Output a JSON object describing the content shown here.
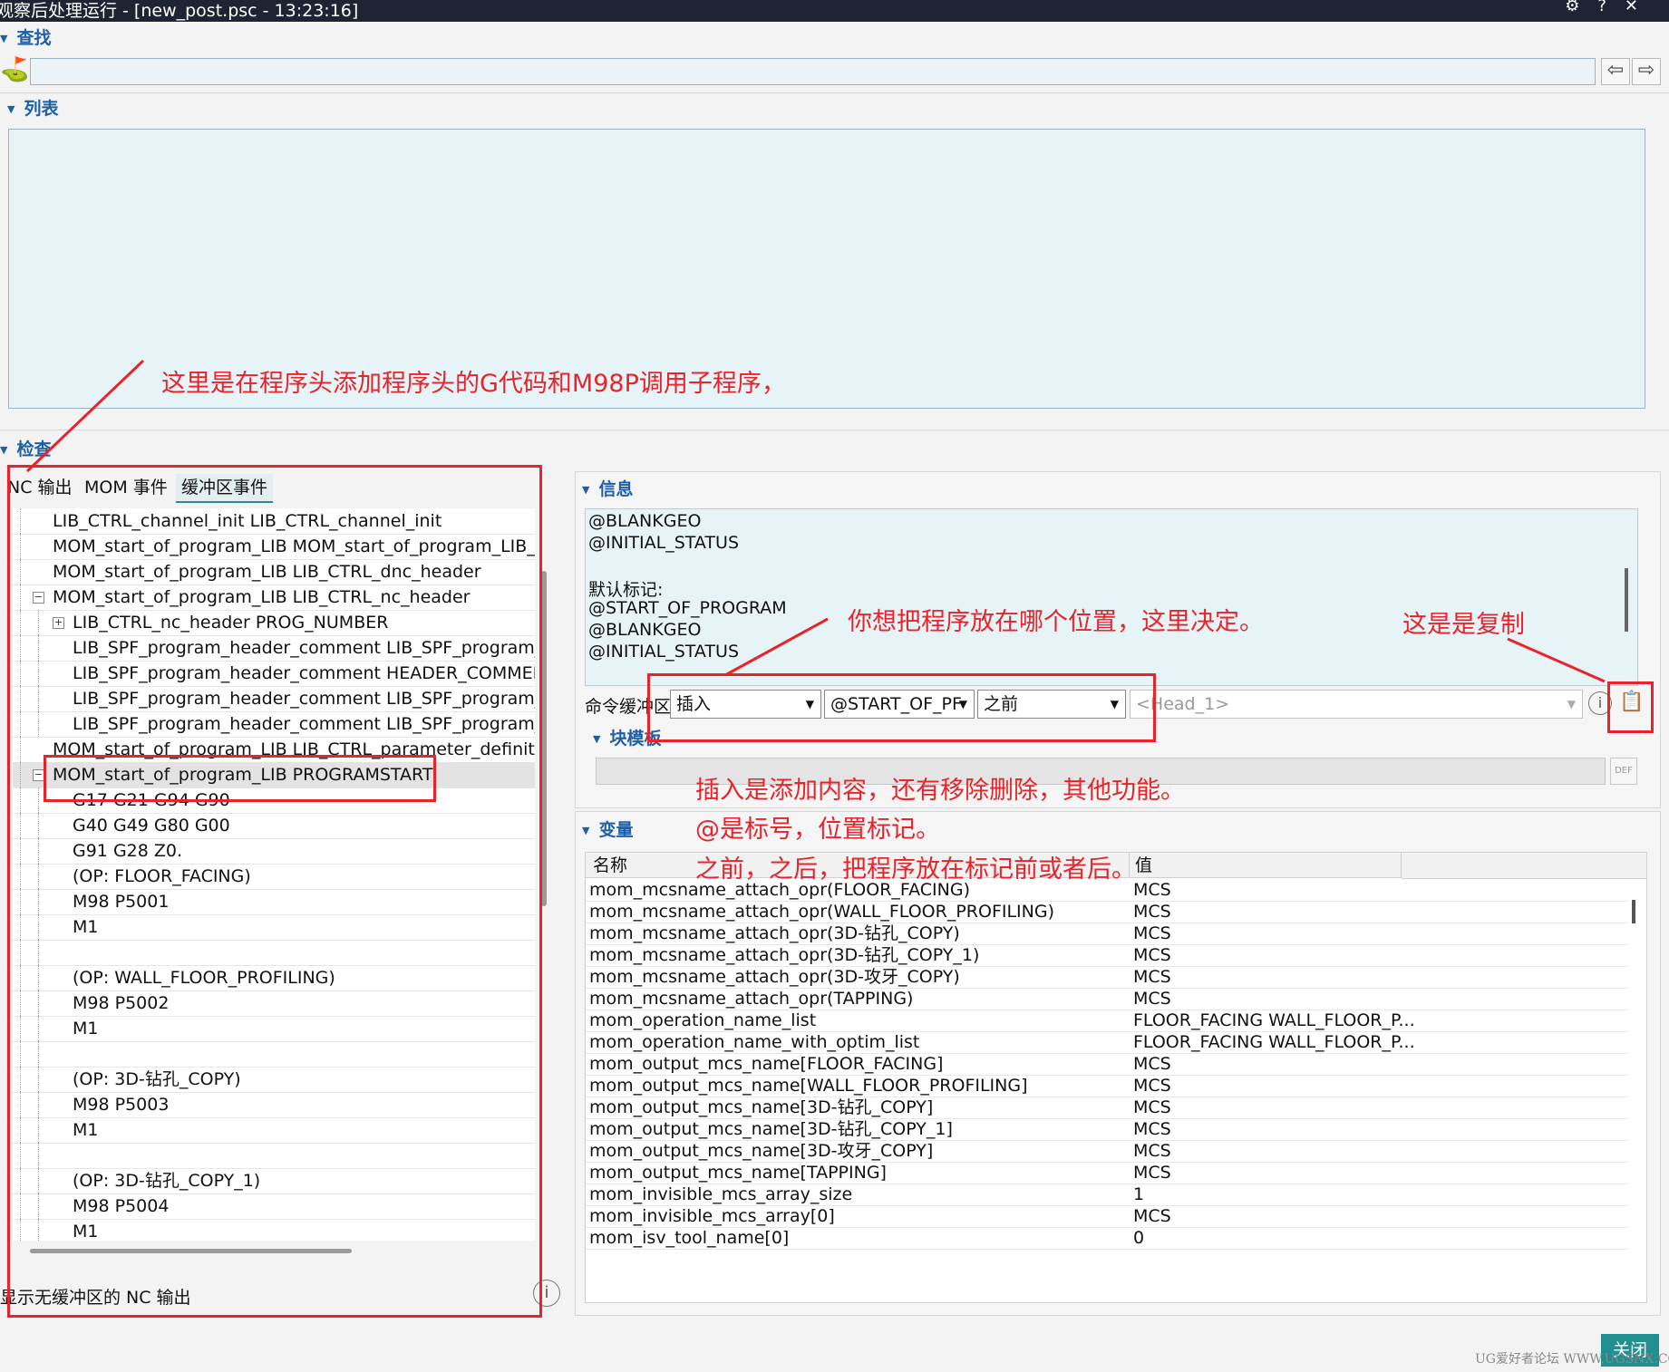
{
  "window": {
    "title": "观察后处理运行 - [new_post.psc - 13:23:16]",
    "icons": [
      "gear-icon",
      "help-icon",
      "close-icon"
    ]
  },
  "find_section": {
    "label": "查找",
    "search_value": ""
  },
  "list_section": {
    "label": "列表"
  },
  "inspect_section": {
    "label": "检查",
    "tabs": [
      "NC 输出",
      "MOM 事件",
      "缓冲区事件"
    ],
    "active_tab": "缓冲区事件",
    "tree": [
      {
        "text": "LIB_CTRL_channel_init LIB_CTRL_channel_init",
        "level": 1,
        "toggle": ""
      },
      {
        "text": "MOM_start_of_program_LIB MOM_start_of_program_LIB_ENT",
        "level": 1,
        "toggle": ""
      },
      {
        "text": "MOM_start_of_program_LIB LIB_CTRL_dnc_header",
        "level": 1,
        "toggle": ""
      },
      {
        "text": "MOM_start_of_program_LIB LIB_CTRL_nc_header",
        "level": 1,
        "toggle": "−"
      },
      {
        "text": "LIB_CTRL_nc_header PROG_NUMBER",
        "level": 2,
        "toggle": "+"
      },
      {
        "text": "LIB_SPF_program_header_comment LIB_SPF_program_heac",
        "level": 2,
        "toggle": ""
      },
      {
        "text": "LIB_SPF_program_header_comment HEADER_COMMENT",
        "level": 2,
        "toggle": ""
      },
      {
        "text": "LIB_SPF_program_header_comment LIB_SPF_program_heac",
        "level": 2,
        "toggle": ""
      },
      {
        "text": "LIB_SPF_program_header_comment LIB_SPF_program_heac",
        "level": 2,
        "toggle": ""
      },
      {
        "text": "MOM_start_of_program_LIB LIB_CTRL_parameter_definition",
        "level": 1,
        "toggle": ""
      },
      {
        "text": "MOM_start_of_program_LIB PROGRAMSTART",
        "level": 1,
        "toggle": "−",
        "selected": true
      },
      {
        "text": "G17 G21 G94 G90",
        "level": 2,
        "toggle": ""
      },
      {
        "text": "G40 G49 G80 G00",
        "level": 2,
        "toggle": ""
      },
      {
        "text": "G91 G28 Z0.",
        "level": 2,
        "toggle": ""
      },
      {
        "text": "(OP: FLOOR_FACING)",
        "level": 2,
        "toggle": ""
      },
      {
        "text": "M98 P5001",
        "level": 2,
        "toggle": ""
      },
      {
        "text": "M1",
        "level": 2,
        "toggle": ""
      },
      {
        "text": "",
        "level": 2,
        "toggle": ""
      },
      {
        "text": "(OP: WALL_FLOOR_PROFILING)",
        "level": 2,
        "toggle": ""
      },
      {
        "text": "M98 P5002",
        "level": 2,
        "toggle": ""
      },
      {
        "text": "M1",
        "level": 2,
        "toggle": ""
      },
      {
        "text": "",
        "level": 2,
        "toggle": ""
      },
      {
        "text": "(OP: 3D-钻孔_COPY)",
        "level": 2,
        "toggle": ""
      },
      {
        "text": "M98 P5003",
        "level": 2,
        "toggle": ""
      },
      {
        "text": "M1",
        "level": 2,
        "toggle": ""
      },
      {
        "text": "",
        "level": 2,
        "toggle": ""
      },
      {
        "text": "(OP: 3D-钻孔_COPY_1)",
        "level": 2,
        "toggle": ""
      },
      {
        "text": "M98 P5004",
        "level": 2,
        "toggle": ""
      },
      {
        "text": "M1",
        "level": 2,
        "toggle": ""
      }
    ],
    "show_nc_label": "显示无缓冲区的 NC 输出"
  },
  "info_section": {
    "label": "信息",
    "lines": [
      "@BLANKGEO",
      "@INITIAL_STATUS",
      "",
      "默认标记:",
      "@START_OF_PROGRAM",
      "@BLANKGEO",
      "@INITIAL_STATUS"
    ],
    "buffer_label": "命令缓冲区",
    "action_value": "插入",
    "marker_value": "@START_OF_PF",
    "position_value": "之前",
    "template_placeholder": "<Head_1>",
    "block_template_label": "块模板"
  },
  "variables_section": {
    "label": "变量",
    "columns": [
      "名称",
      "值"
    ],
    "rows": [
      [
        "mom_mcsname_attach_opr(FLOOR_FACING)",
        "MCS"
      ],
      [
        "mom_mcsname_attach_opr(WALL_FLOOR_PROFILING)",
        "MCS"
      ],
      [
        "mom_mcsname_attach_opr(3D-钻孔_COPY)",
        "MCS"
      ],
      [
        "mom_mcsname_attach_opr(3D-钻孔_COPY_1)",
        "MCS"
      ],
      [
        "mom_mcsname_attach_opr(3D-攻牙_COPY)",
        "MCS"
      ],
      [
        "mom_mcsname_attach_opr(TAPPING)",
        "MCS"
      ],
      [
        "mom_operation_name_list",
        "FLOOR_FACING WALL_FLOOR_P..."
      ],
      [
        "mom_operation_name_with_optim_list",
        "FLOOR_FACING WALL_FLOOR_P..."
      ],
      [
        "mom_output_mcs_name[FLOOR_FACING]",
        "MCS"
      ],
      [
        "mom_output_mcs_name[WALL_FLOOR_PROFILING]",
        "MCS"
      ],
      [
        "mom_output_mcs_name[3D-钻孔_COPY]",
        "MCS"
      ],
      [
        "mom_output_mcs_name[3D-钻孔_COPY_1]",
        "MCS"
      ],
      [
        "mom_output_mcs_name[3D-攻牙_COPY]",
        "MCS"
      ],
      [
        "mom_output_mcs_name[TAPPING]",
        "MCS"
      ],
      [
        "mom_invisible_mcs_array_size",
        "1"
      ],
      [
        "mom_invisible_mcs_array[0]",
        "MCS"
      ],
      [
        "mom_isv_tool_name[0]",
        "0"
      ]
    ]
  },
  "annotations": {
    "a1": "这里是在程序头添加程序头的G代码和M98P调用子程序，",
    "a2": "你想把程序放在哪个位置，这里决定。",
    "a3": "这是是复制",
    "a4": "插入是添加内容，还有移除删除，其他功能。",
    "a5": "@是标号，位置标记。",
    "a6": "之前，之后，把程序放在标记前或者后。"
  },
  "close_label": "关闭",
  "watermark": "UG爱好者论坛 WWW.UGSNX.COM",
  "colors": {
    "accent": "#1f5fa8",
    "annotation": "#e8242a",
    "teal_button": "#1f8f8f"
  }
}
